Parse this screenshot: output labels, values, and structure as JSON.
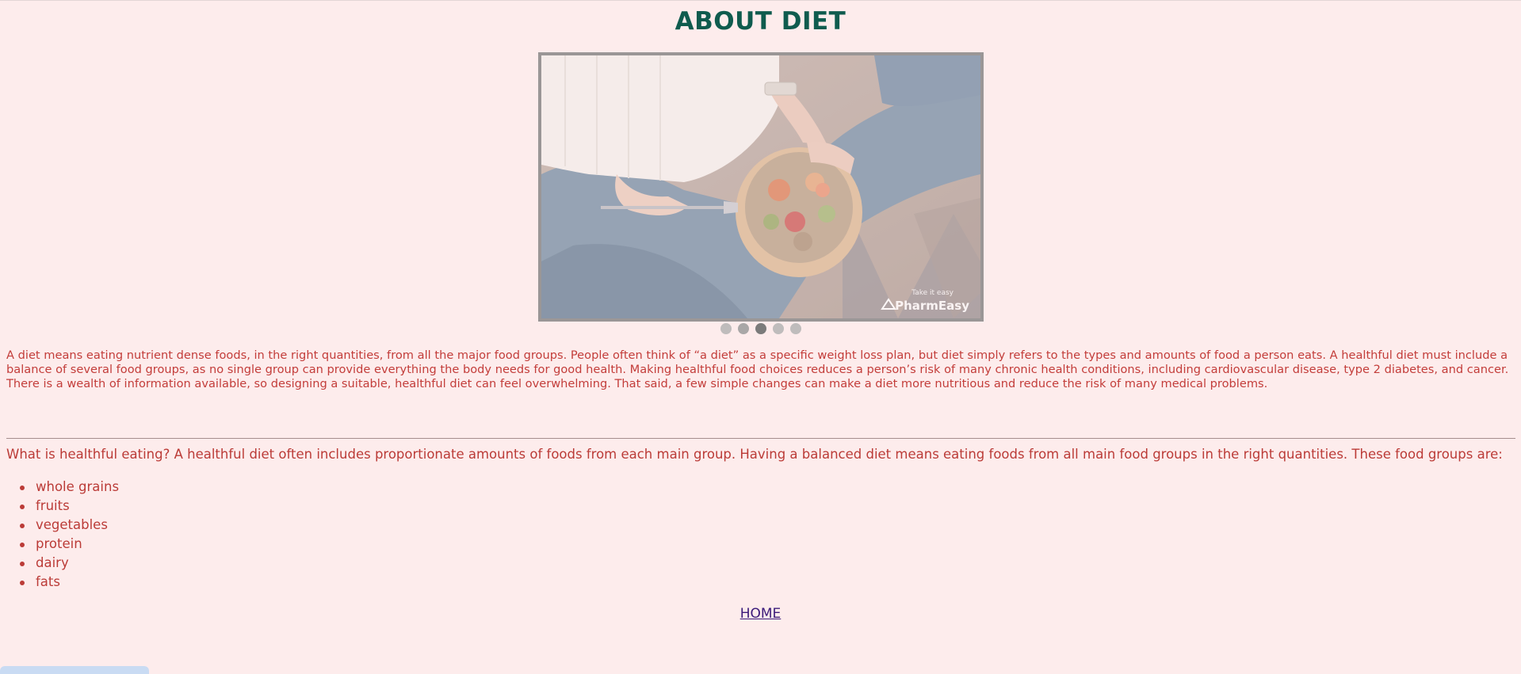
{
  "page": {
    "title": "ABOUT DIET",
    "intro": "A diet means eating nutrient dense foods, in the right quantities, from all the major food groups. People often think of “a diet” as a specific weight loss plan, but diet simply refers to the types and amounts of food a person eats. A healthful diet must include a balance of several food groups, as no single group can provide everything the body needs for good health. Making healthful food choices reduces a person’s risk of many chronic health conditions, including cardiovascular disease, type 2 diabetes, and cancer. There is a wealth of information available, so designing a suitable, healthful diet can feel overwhelming. That said, a few simple changes can make a diet more nutritious and reduce the risk of many medical problems.",
    "lead": "What is healthful eating? A healthful diet often includes proportionate amounts of foods from each main group. Having a balanced diet means eating foods from all main food groups in the right quantities. These food groups are:",
    "food_groups": [
      "whole grains",
      "fruits",
      "vegetables",
      "protein",
      "dairy",
      "fats"
    ],
    "home_link": "HOME"
  },
  "carousel": {
    "image": "woman holding a bowl of healthy salad",
    "watermark_tagline": "Take it easy",
    "watermark_brand": "PharmEasy",
    "slide_count": 5,
    "active_slide": 3
  },
  "colors": {
    "background": "#fdecec",
    "title": "#0f5b4e",
    "body_text": "#c33d3a",
    "link": "#3b1a7a"
  }
}
